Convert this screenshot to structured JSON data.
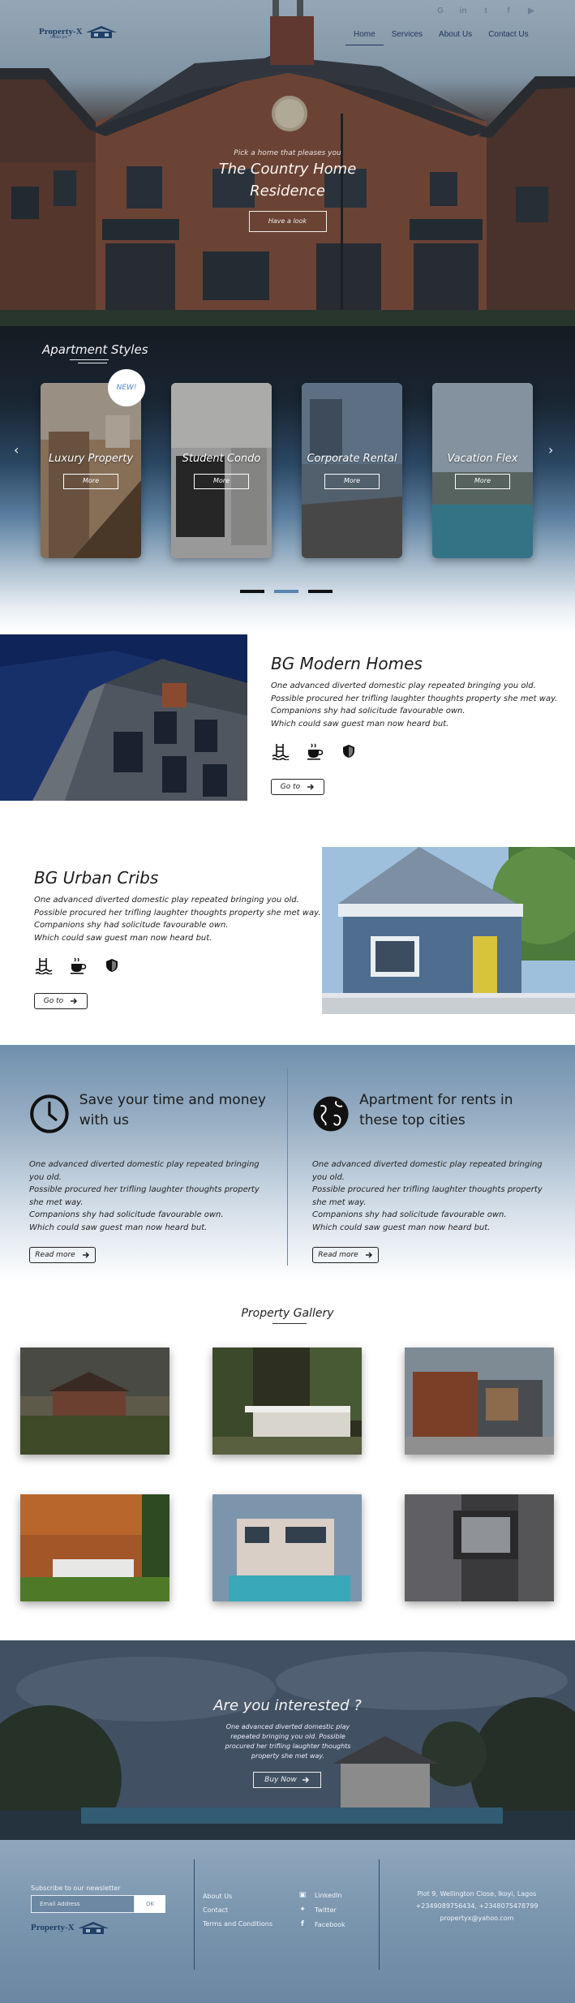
{
  "brand": {
    "name": "Property-X",
    "tagline": "realtor pro"
  },
  "socials": [
    "G",
    "in",
    "t",
    "f",
    "▶"
  ],
  "nav": {
    "items": [
      "Home",
      "Services",
      "About Us",
      "Contact Us"
    ],
    "active": "Home"
  },
  "hero": {
    "kicker": "Pick a home that pleases you",
    "title_line1": "The Country Home",
    "title_line2": "Residence",
    "button": "Have a look"
  },
  "styles": {
    "title": "Apartment Styles",
    "badge": "NEW!",
    "prev_icon": "‹",
    "next_icon": "›",
    "cards": [
      {
        "title": "Luxury Property",
        "button": "More"
      },
      {
        "title": "Student Condo",
        "button": "More"
      },
      {
        "title": "Corporate Rental",
        "button": "More"
      },
      {
        "title": "Vacation Flex",
        "button": "More"
      }
    ],
    "active_dot": 2
  },
  "features": [
    {
      "title": "BG Modern Homes",
      "body": [
        "One advanced diverted domestic play repeated bringing you old.",
        "Possible procured her trifling laughter thoughts property she met way.",
        "Companions shy had solicitude favourable own.",
        "Which could saw guest man now heard but."
      ],
      "button": "Go to"
    },
    {
      "title": "BG Urban Cribs",
      "body": [
        "One advanced diverted domestic play repeated bringing you old.",
        "Possible procured her trifling laughter thoughts property she met way.",
        "Companions shy had solicitude favourable own.",
        "Which could saw guest man now heard but."
      ],
      "button": "Go to"
    }
  ],
  "columns": [
    {
      "title": "Save your time and money with us",
      "body": [
        "One advanced diverted domestic play repeated bringing you old.",
        "Possible procured her trifling laughter thoughts property she met way.",
        "Companions shy had solicitude favourable own.",
        "Which could saw guest man now heard but."
      ],
      "button": "Read more"
    },
    {
      "title": "Apartment for rents in these top cities",
      "body": [
        "One advanced diverted domestic play repeated bringing you old.",
        "Possible procured her trifling laughter thoughts property she met way.",
        "Companions shy had solicitude favourable own.",
        "Which could saw guest man now heard but."
      ],
      "button": "Read more"
    }
  ],
  "gallery": {
    "title": "Property Gallery"
  },
  "interest": {
    "title": "Are you interested ?",
    "body": "One advanced diverted domestic play repeated bringing you old. Possible procured her trifling laughter thoughts property she met way.",
    "button": "Buy Now"
  },
  "footer": {
    "subscribe_label": "Subscribe to our newsletter",
    "email_placeholder": "Email Address",
    "ok": "OK",
    "links": [
      "About Us",
      "Contact",
      "Terms and Conditions"
    ],
    "socials": [
      {
        "icon": "linkedin-icon",
        "label": "LinkedIn"
      },
      {
        "icon": "twitter-icon",
        "label": "Twitter"
      },
      {
        "icon": "facebook-icon",
        "label": "Facebook"
      }
    ],
    "address": "Plot 9, Wellington Close, Ikoyi, Lagos",
    "phones": "+2349089756434, +2348075478799",
    "email": "propertyx@yahoo.com"
  },
  "colors": {
    "accent": "#4e87c6",
    "navy": "#1f3f66",
    "footer": "#7b96ae"
  }
}
